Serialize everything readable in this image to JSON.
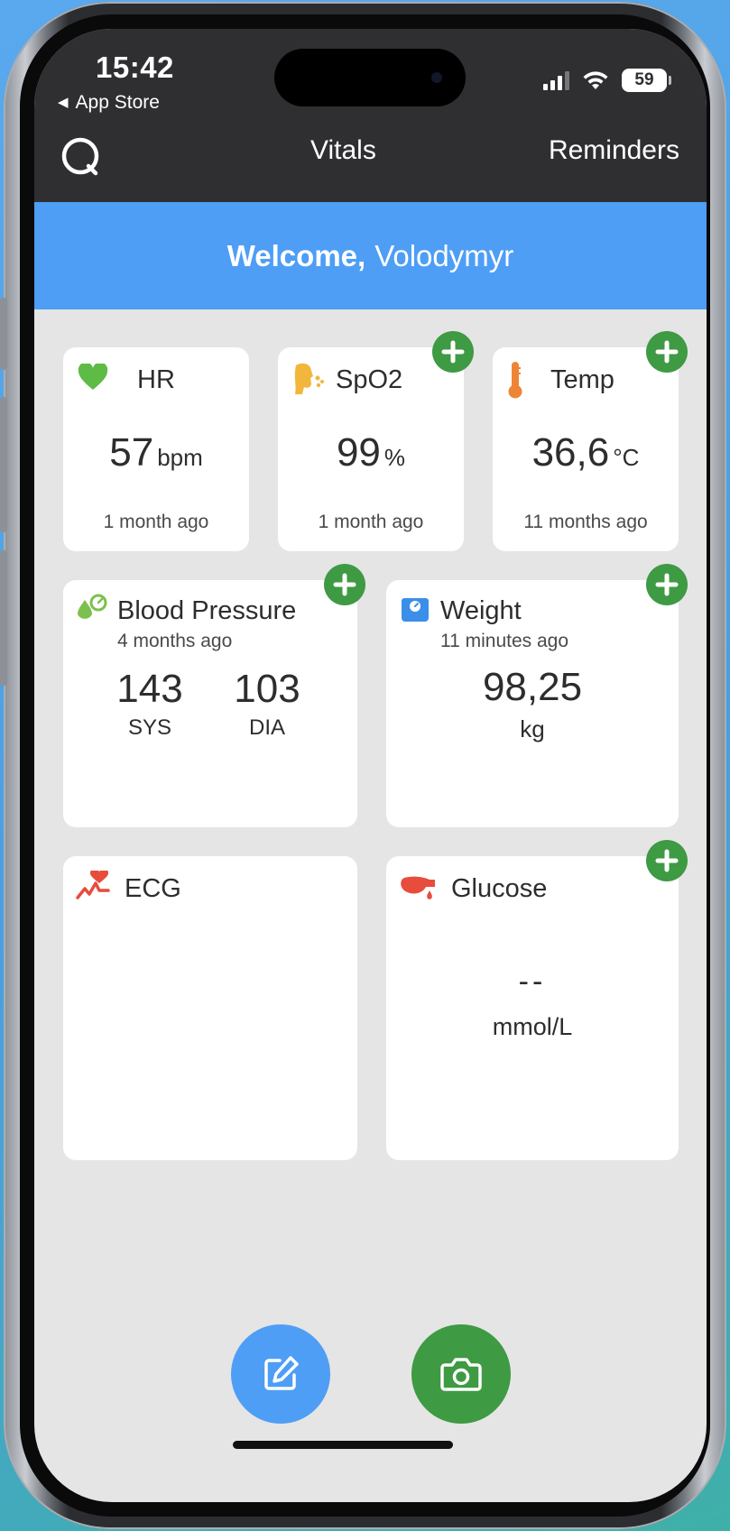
{
  "status_bar": {
    "time": "15:42",
    "back_label": "App Store",
    "battery": "59"
  },
  "nav": {
    "logo_icon": "app-logo-icon",
    "tab_vitals": "Vitals",
    "tab_reminders": "Reminders"
  },
  "welcome": {
    "prefix": "Welcome,",
    "name": "Volodymyr"
  },
  "cards": {
    "hr": {
      "title": "HR",
      "value": "57",
      "unit": "bpm",
      "ago": "1 month ago",
      "icon": "heart-icon"
    },
    "spo2": {
      "title": "SpO2",
      "value": "99",
      "unit": "%",
      "ago": "1 month ago",
      "icon": "breath-icon"
    },
    "temp": {
      "title": "Temp",
      "value": "36,6",
      "unit": "°C",
      "ago": "11 months ago",
      "icon": "thermometer-icon"
    },
    "bp": {
      "title": "Blood Pressure",
      "ago": "4 months ago",
      "sys": "143",
      "sys_label": "SYS",
      "dia": "103",
      "dia_label": "DIA",
      "icon": "blood-pressure-icon"
    },
    "weight": {
      "title": "Weight",
      "ago": "11 minutes ago",
      "value": "98,25",
      "unit": "kg",
      "icon": "scale-icon"
    },
    "ecg": {
      "title": "ECG",
      "icon": "ecg-icon"
    },
    "glucose": {
      "title": "Glucose",
      "value": "--",
      "unit": "mmol/L",
      "icon": "glucose-icon"
    }
  },
  "actions": {
    "edit_icon": "edit-icon",
    "camera_icon": "camera-icon"
  },
  "colors": {
    "header": "#2f2f32",
    "banner": "#4e9ef5",
    "add_button": "#3e9a43",
    "edit_fab": "#4e9ef5",
    "camera_fab": "#3e9a43",
    "screen_bg": "#e5e5e5"
  }
}
